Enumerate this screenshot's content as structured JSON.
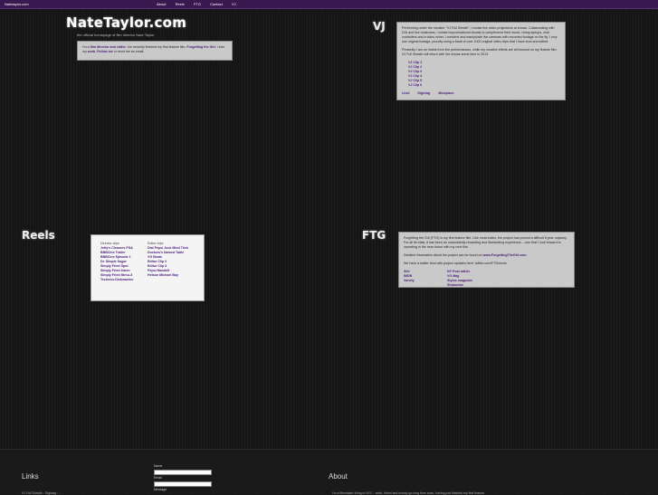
{
  "topbar": {
    "brand": "Natetaylor.com",
    "nav": [
      "About",
      "Reels",
      "FTG",
      "Contact",
      "VJ"
    ]
  },
  "header": {
    "title": "NateTaylor.com",
    "tagline": "the official homepage of film director Nate Taylor"
  },
  "intro": {
    "text_start": "I'm a",
    "link1": "film director and editor.",
    "text_mid": "I've recently finished my first feature film,",
    "link2": "Forgetting the Girl.",
    "text_mid2": "I love my",
    "link3": "work.",
    "link4": "Follow me",
    "text_end": "or send me an email."
  },
  "vj": {
    "title": "VJ",
    "para1": "Performing under the moniker \"VJ Full Sheath\", I create live video projections at shows. Collaborating with DJs and live musicians, I create improvisational visuals to complement their music. Using laptops, midi controllers and a video mixer, I combine and manipulate live cameras with recorded footage on the fly. I only use original footage, proudly using a bank of over 1000 original video clips that I have shot and edited.",
    "para2": "Presently I am on hiatus from live performances, while my creative efforts are all focused on my feature film. VJ Full Sheath will return with live shows some time in 2013.",
    "clips": [
      "VJ Clip 1",
      "VJ Clip 2",
      "VJ Clip 3",
      "VJ Clip 4",
      "VJ Clip 5",
      "VJ Clip 6"
    ],
    "links": [
      "Livid",
      "Digiclag",
      "Mixxplace"
    ]
  },
  "reels": {
    "title": "Reels",
    "col1_header": "Director clips",
    "col1": [
      "Jetty's Cleaners PSA",
      "BBBCine Trailer",
      "BBBCine Episode 1",
      "Dr. Simple Sugar",
      "Simply Fried Spot",
      "Simply Fried Intern",
      "Simply Fried Menu-3",
      "Technics Dishwasher"
    ],
    "col2_header": "Editor clips",
    "col2": [
      "Dial Pepsi Jock Mind Trick",
      "Dockers's Named Table",
      "VG Beats",
      "Editor Clip 2",
      "Editor Clip 3",
      "Pepsi Mandrill",
      "Hetson Michael Bay"
    ]
  },
  "ftg": {
    "title": "FTG",
    "para1": "Forgetting the Girl (FTG) is my first feature film. Like most indies, the project has proved a difficult 8 year odyssey. For all its trials, it has been an undoubtedly rewarding and illuminating experience -- one that I look forward to repeating in the near future with my next film.",
    "para2_text": "Detailed information about the project can be found on",
    "para2_link": "www.ForgettingTheGirl.com",
    "para3": "We have a twitter feed with project updates here: twitter.com/FTGmovie",
    "grid": [
      "Site",
      "NY Post article",
      "IMDB",
      "VG Mag",
      "Variety",
      "Stylus magazine",
      "",
      "Shabuzine"
    ]
  },
  "footer": {
    "links_title": "Links",
    "links_text": "VJ Full Sheath · Digiclag · ...",
    "name_label": "Name",
    "email_label": "Email",
    "message_label": "Message",
    "about_title": "About",
    "about_text": "I'm a filmmaker living in NYC - write, direct and mostly go long form work, having just finished my first feature"
  }
}
